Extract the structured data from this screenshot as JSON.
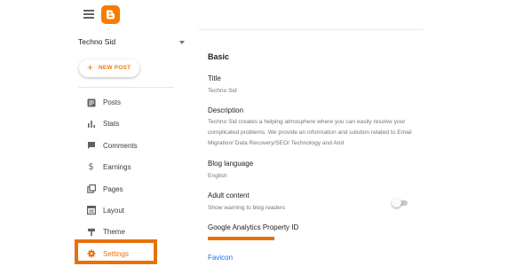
{
  "header": {
    "menu_icon": "hamburger-icon",
    "logo": "blogger-logo",
    "brand_color": "#f57c00"
  },
  "blog_selector": {
    "name": "Techno Sid",
    "icon": "chevron-down-icon"
  },
  "new_post": {
    "label": "NEW POST",
    "icon": "plus-icon"
  },
  "nav": {
    "accent_color": "#e8710a",
    "items": [
      {
        "label": "Posts",
        "icon": "posts-icon"
      },
      {
        "label": "Stats",
        "icon": "stats-icon"
      },
      {
        "label": "Comments",
        "icon": "comments-icon"
      },
      {
        "label": "Earnings",
        "icon": "earnings-icon"
      },
      {
        "label": "Pages",
        "icon": "pages-icon"
      },
      {
        "label": "Layout",
        "icon": "layout-icon"
      },
      {
        "label": "Theme",
        "icon": "theme-icon"
      },
      {
        "label": "Settings",
        "icon": "gear-icon",
        "active": true
      }
    ]
  },
  "main": {
    "section_title": "Basic",
    "title": {
      "label": "Title",
      "value": "Techno Sid"
    },
    "description": {
      "label": "Description",
      "value": "Techno Sid creates a helping atmosphere where you can easily resolve your complicated problems. We provide an information and solution related to Email Migration/ Data Recovery/SEO/ Technology and And"
    },
    "blog_language": {
      "label": "Blog language",
      "value": "English"
    },
    "adult_content": {
      "label": "Adult content",
      "value": "Show warning to blog readers",
      "enabled": false
    },
    "google_analytics": {
      "label": "Google Analytics Property ID"
    },
    "favicon": {
      "label": "Favicon"
    }
  }
}
